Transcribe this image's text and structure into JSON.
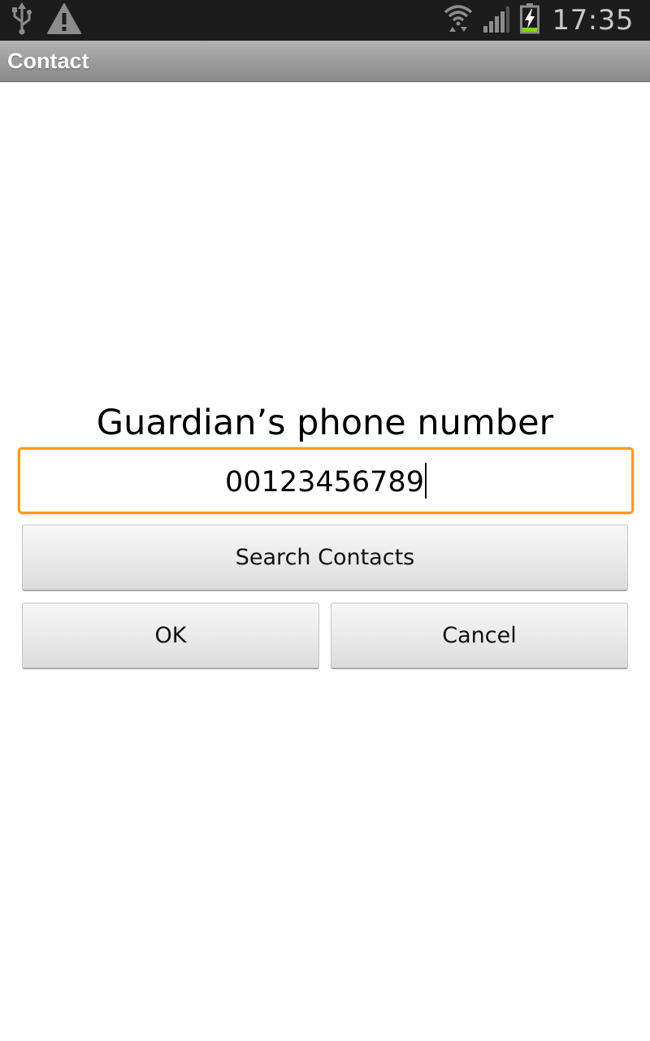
{
  "status_bar": {
    "time": "17:35",
    "icons": [
      "usb-icon",
      "warning-icon",
      "wifi-icon",
      "signal-icon",
      "battery-charging-icon"
    ]
  },
  "title_bar": {
    "title": "Contact"
  },
  "form": {
    "prompt": "Guardian’s phone number",
    "phone_value": "00123456789",
    "field_accent": "#f59d1b"
  },
  "buttons": {
    "search_contacts": "Search Contacts",
    "ok": "OK",
    "cancel": "Cancel"
  }
}
